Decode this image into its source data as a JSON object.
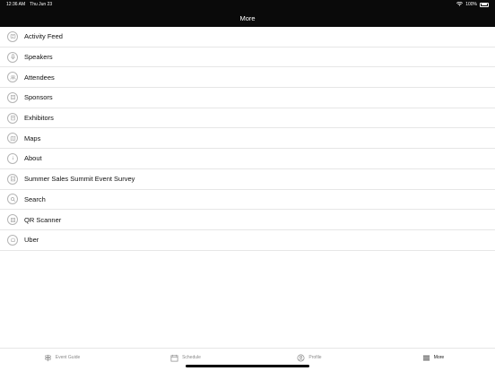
{
  "status_bar": {
    "time": "12:36 AM",
    "date": "Thu Jun 23",
    "battery": "100%"
  },
  "nav": {
    "title": "More"
  },
  "menu": {
    "items": [
      {
        "label": "Activity Feed",
        "icon": "activity-feed-icon"
      },
      {
        "label": "Speakers",
        "icon": "speakers-icon"
      },
      {
        "label": "Attendees",
        "icon": "attendees-icon"
      },
      {
        "label": "Sponsors",
        "icon": "sponsors-icon"
      },
      {
        "label": "Exhibitors",
        "icon": "exhibitors-icon"
      },
      {
        "label": "Maps",
        "icon": "maps-icon"
      },
      {
        "label": "About",
        "icon": "about-icon"
      },
      {
        "label": "Summer Sales Summit Event Survey",
        "icon": "survey-icon"
      },
      {
        "label": "Search",
        "icon": "search-icon"
      },
      {
        "label": "QR Scanner",
        "icon": "qr-scanner-icon"
      },
      {
        "label": "Uber",
        "icon": "uber-icon"
      }
    ]
  },
  "tabs": [
    {
      "label": "Event Guide",
      "icon": "event-guide-icon"
    },
    {
      "label": "Schedule",
      "icon": "calendar-icon"
    },
    {
      "label": "Profile",
      "icon": "profile-icon"
    },
    {
      "label": "More",
      "icon": "hamburger-menu-icon",
      "active": true
    }
  ]
}
